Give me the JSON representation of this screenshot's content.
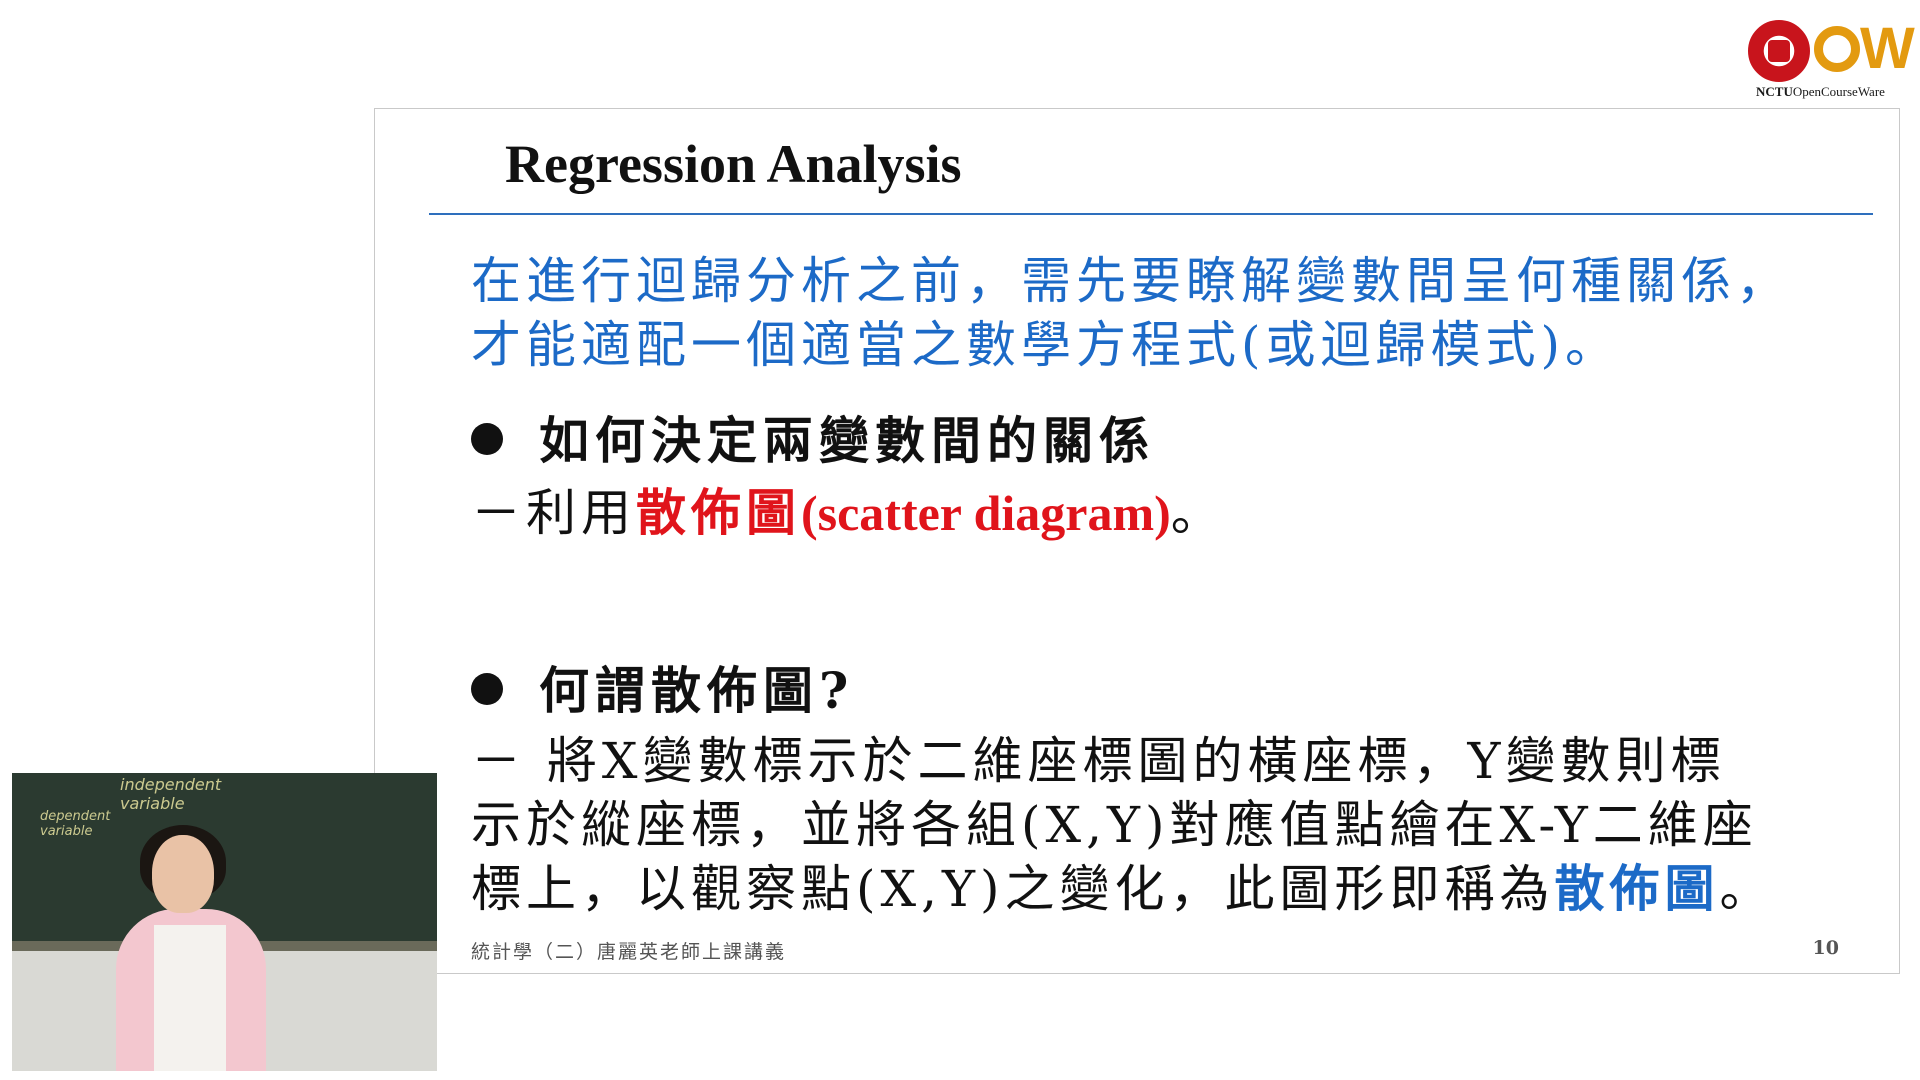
{
  "logo": {
    "brand": "NCTU",
    "subtitle": "OpenCourseWare"
  },
  "slide": {
    "title": "Regression Analysis",
    "intro_line1": "在進行迴歸分析之前，需先要瞭解變數間呈何種關係，",
    "intro_line2": "才能適配一個適當之數學方程式(或迴歸模式)。",
    "bullet1": "如何決定兩變數間的關係",
    "sub1_prefix": "－利用",
    "sub1_highlight_cn": "散佈圖",
    "sub1_highlight_en": "(scatter diagram)",
    "sub1_suffix": "。",
    "bullet2": "何謂散佈圖?",
    "sub2_line1": "－ 將X變數標示於二維座標圖的橫座標，Y變數則標",
    "sub2_line2": "示於縱座標，並將各組(X,Y)對應值點繪在X-Y二維座",
    "sub2_line3_prefix": "標上，以觀察點(X,Y)之變化，此圖形即稱為",
    "sub2_line3_highlight": "散佈圖",
    "sub2_line3_suffix": "。",
    "footer": "統計學（二）唐麗英老師上課講義",
    "page_number": "10"
  },
  "colors": {
    "accent_blue": "#1c6ac7",
    "accent_red": "#e0141b",
    "rule_blue": "#2e6fbd",
    "logo_red": "#c8141c",
    "logo_orange": "#e39a10"
  }
}
